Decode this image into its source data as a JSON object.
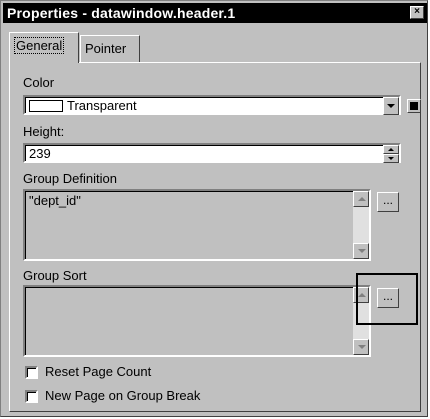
{
  "window": {
    "title": "Properties -  datawindow.header.1",
    "close_glyph": "×"
  },
  "tabs": [
    {
      "label": "General",
      "active": true
    },
    {
      "label": "Pointer",
      "active": false
    }
  ],
  "color": {
    "label": "Color",
    "value": "Transparent",
    "swatch": "#ffffff"
  },
  "height": {
    "label": "Height:",
    "value": "239"
  },
  "group_definition": {
    "label": "Group Definition",
    "value": "\"dept_id\"",
    "button_label": "..."
  },
  "group_sort": {
    "label": "Group Sort",
    "value": "",
    "button_label": "..."
  },
  "checkboxes": [
    {
      "label": "Reset Page Count",
      "checked": false
    },
    {
      "label": "New Page on Group Break",
      "checked": false
    }
  ]
}
